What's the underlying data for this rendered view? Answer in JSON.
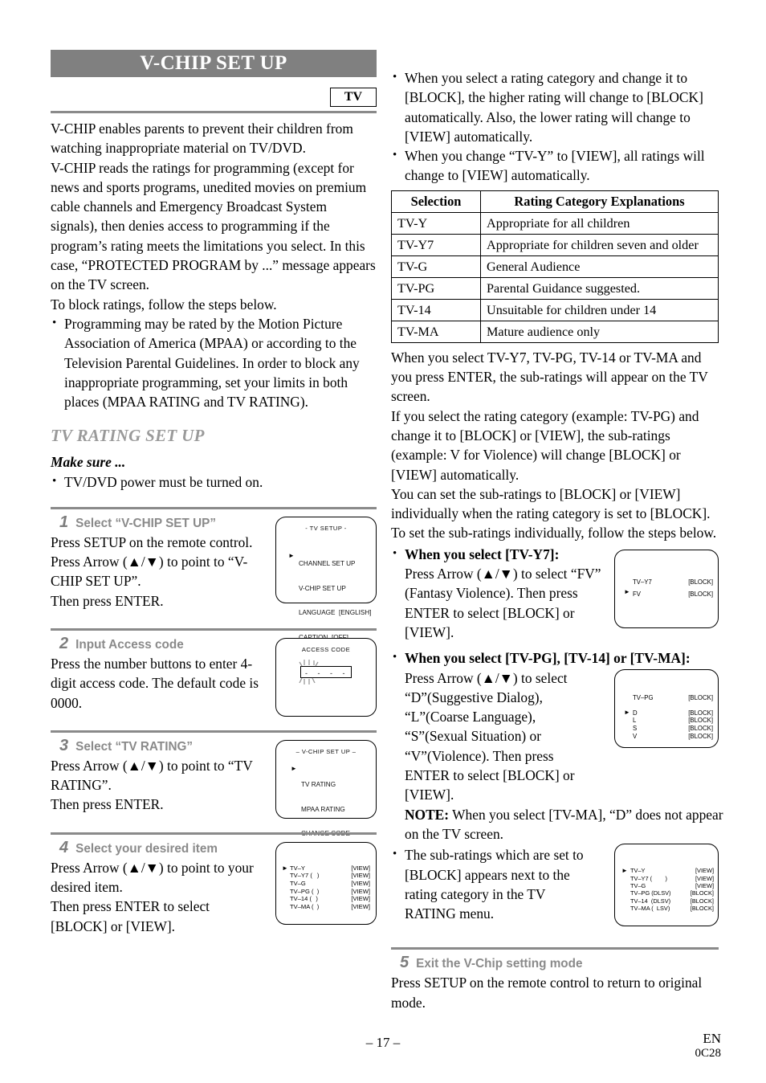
{
  "header": {
    "title": "V-CHIP SET UP",
    "badge": "TV"
  },
  "intro": {
    "p1": "V-CHIP enables parents to prevent their children from watching inappropriate material on TV/DVD.",
    "p2": "V-CHIP reads the ratings for programming (except for news and sports programs, unedited movies on premium cable channels and Emergency Broadcast System signals), then denies access to programming if the program’s rating meets the limitations you select. In this case, “PROTECTED PROGRAM by ...” message appears on the TV screen.",
    "p3": "To block ratings, follow the steps below.",
    "bullet1": "Programming may be rated by the Motion Picture Association of America (MPAA) or according to the Television Parental Guidelines. In order to block any inappropriate programming, set your limits in both places (MPAA RATING and TV RATING)."
  },
  "section": {
    "heading": "TV RATING SET UP",
    "make_sure_label": "Make sure ...",
    "make_sure_bullet": "TV/DVD power must be turned on."
  },
  "steps": [
    {
      "num": "1",
      "title": "Select “V-CHIP SET UP”",
      "lines": [
        "Press SETUP on the remote control.",
        "Press Arrow (▲/▼) to point to “V-CHIP SET UP”.",
        "Then press ENTER."
      ],
      "screen": {
        "title": "- TV SETUP -",
        "caret_index": 1,
        "rows": [
          "CHANNEL SET UP",
          "V-CHIP SET UP",
          "LANGUAGE  [ENGLISH]",
          "CAPTION  [OFF]"
        ]
      }
    },
    {
      "num": "2",
      "title": "Input Access code",
      "lines": [
        "Press the number buttons to enter 4-digit access code. The default code is 0000."
      ],
      "screen": {
        "title": "ACCESS CODE",
        "code_field": "-  -  -  -"
      }
    },
    {
      "num": "3",
      "title": "Select “TV RATING”",
      "lines": [
        "Press Arrow (▲/▼) to point to “TV RATING”.",
        "Then press ENTER."
      ],
      "screen": {
        "title": "– V-CHIP SET UP –",
        "caret_index": 0,
        "rows": [
          "TV RATING",
          "MPAA RATING",
          "CHANGE CODE"
        ]
      }
    },
    {
      "num": "4",
      "title": "Select your desired item",
      "lines": [
        "Press Arrow (▲/▼) to point to your desired item.",
        "Then press ENTER to select [BLOCK] or [VIEW]."
      ],
      "screen": {
        "caret_index": 0,
        "rows": [
          {
            "label": "TV–Y",
            "sub": "",
            "value": "[VIEW]"
          },
          {
            "label": "TV–Y7 (",
            "sub": ")",
            "value": "[VIEW]"
          },
          {
            "label": "TV–G",
            "sub": "",
            "value": "[VIEW]"
          },
          {
            "label": "TV–PG (",
            "sub": ")",
            "value": "[VIEW]"
          },
          {
            "label": "TV–14 (",
            "sub": ")",
            "value": "[VIEW]"
          },
          {
            "label": "TV–MA (",
            "sub": ")",
            "value": "[VIEW]"
          }
        ]
      }
    },
    {
      "num": "5",
      "title": "Exit the V-Chip setting mode",
      "lines": [
        "Press SETUP on the remote control to return to original mode."
      ]
    }
  ],
  "right": {
    "bullet1": "When you select a rating category and change it to [BLOCK], the higher rating will change to [BLOCK] automatically. Also, the lower rating will change to [VIEW] automatically.",
    "bullet2": "When you change “TV-Y” to [VIEW], all ratings will change to [VIEW] automatically.",
    "table": {
      "headers": [
        "Selection",
        "Rating Category Explanations"
      ],
      "rows": [
        [
          "TV-Y",
          "Appropriate for all children"
        ],
        [
          "TV-Y7",
          "Appropriate for children seven and older"
        ],
        [
          "TV-G",
          "General Audience"
        ],
        [
          "TV-PG",
          "Parental Guidance suggested."
        ],
        [
          "TV-14",
          "Unsuitable for children under 14"
        ],
        [
          "TV-MA",
          "Mature audience only"
        ]
      ]
    },
    "p1": "When you select TV-Y7, TV-PG, TV-14 or TV-MA and you press ENTER, the sub-ratings will appear on the TV screen.",
    "p2": "If you select the rating category (example: TV-PG) and change it to [BLOCK] or [VIEW], the sub-ratings (example: V for Violence) will change [BLOCK] or [VIEW] automatically.",
    "p3": "You can set the sub-ratings to [BLOCK] or [VIEW] individually when the rating category is set to [BLOCK].",
    "p4": "To set the sub-ratings individually, follow the steps below.",
    "sub1": {
      "heading": "When you select [TV-Y7]:",
      "text": "Press Arrow (▲/▼) to select “FV” (Fantasy Violence). Then press ENTER to select [BLOCK] or [VIEW].",
      "screen": {
        "caret_index": 1,
        "rows": [
          {
            "label": "TV–Y7",
            "value": "[BLOCK]"
          },
          {
            "label": "FV",
            "value": "[BLOCK]"
          }
        ]
      }
    },
    "sub2": {
      "heading": "When you select [TV-PG], [TV-14] or [TV-MA]:",
      "text": "Press Arrow (▲/▼) to select “D”(Suggestive Dialog), “L”(Coarse Language), “S”(Sexual Situation) or “V”(Violence). Then press ENTER to select [BLOCK] or [VIEW].",
      "note_label": "NOTE:",
      "note_text": "When you select [TV-MA], “D” does not appear on the TV screen.",
      "screen": {
        "caret_index": 1,
        "rows": [
          {
            "label": "TV–PG",
            "value": "[BLOCK]"
          },
          {
            "label": "D",
            "value": "[BLOCK]"
          },
          {
            "label": "L",
            "value": "[BLOCK]"
          },
          {
            "label": "S",
            "value": "[BLOCK]"
          },
          {
            "label": "V",
            "value": "[BLOCK]"
          }
        ]
      }
    },
    "sub3": {
      "text": "The sub-ratings which are set to [BLOCK] appears next to the rating category in the TV RATING menu.",
      "screen": {
        "caret_index": 0,
        "rows": [
          {
            "label": "TV–Y",
            "value": "[VIEW]"
          },
          {
            "label": "TV–Y7 (        )",
            "value": "[VIEW]"
          },
          {
            "label": "TV–G",
            "value": "[VIEW]"
          },
          {
            "label": "TV–PG (DLSV)",
            "value": "[BLOCK]"
          },
          {
            "label": "TV–14  (DLSV)",
            "value": "[BLOCK]"
          },
          {
            "label": "TV–MA (  LSV)",
            "value": "[BLOCK]"
          }
        ]
      }
    }
  },
  "footer": {
    "page": "– 17 –",
    "lang": "EN",
    "code": "0C28"
  },
  "colors": {
    "title_bar": "#808080",
    "rule": "#8a8a8a",
    "section_heading": "#9a9a9a",
    "step_label": "#8a8a8a"
  }
}
